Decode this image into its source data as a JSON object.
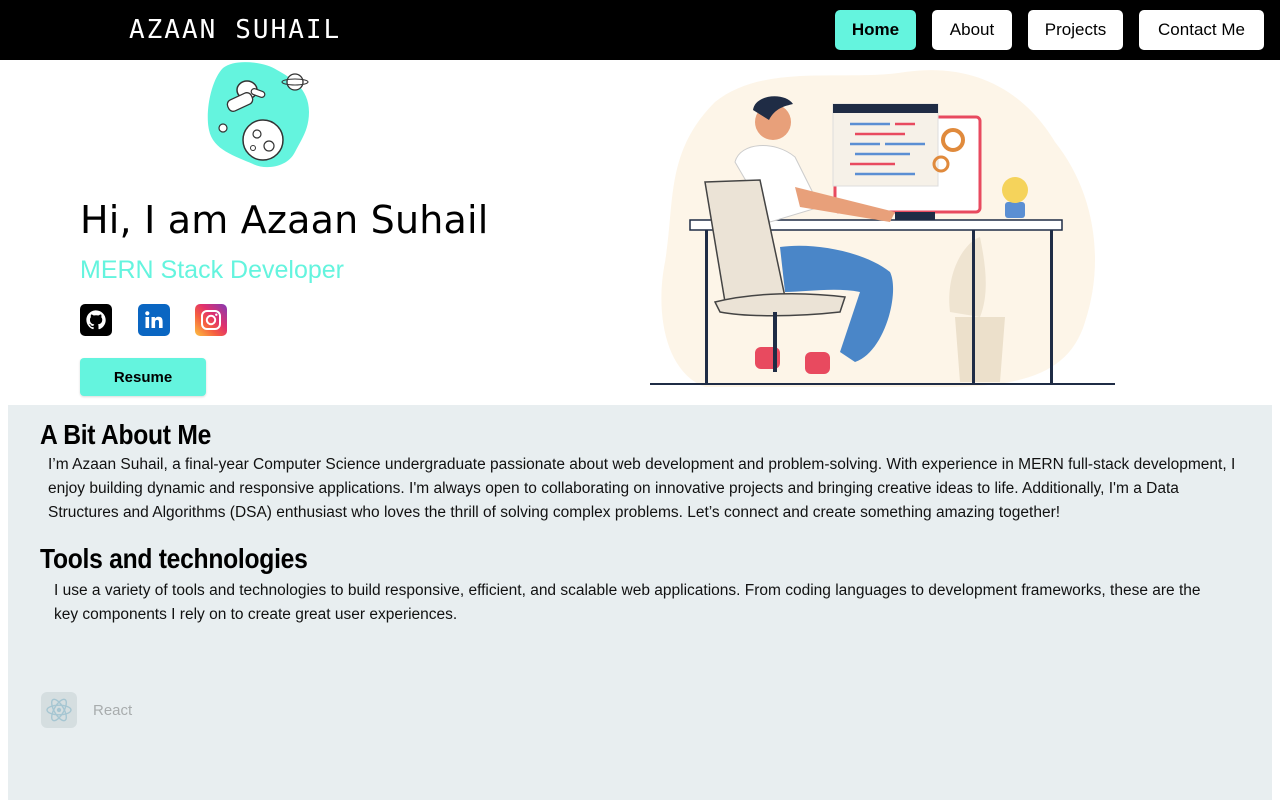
{
  "nav": {
    "brand_first": "AZAAN",
    "brand_second": "SUHAIL",
    "items": [
      {
        "label": "Home",
        "active": true
      },
      {
        "label": "About",
        "active": false
      },
      {
        "label": "Projects",
        "active": false
      },
      {
        "label": "Contact Me",
        "active": false
      }
    ]
  },
  "hero": {
    "title": "Hi, I am Azaan Suhail",
    "subtitle": "MERN Stack Developer",
    "socials": [
      {
        "icon": "github-icon",
        "color": "#000000"
      },
      {
        "icon": "linkedin-icon",
        "color": "#0a66c2"
      },
      {
        "icon": "instagram-icon",
        "color": "#e1306c"
      }
    ],
    "resume_label": "Resume"
  },
  "about": {
    "heading": "A Bit About Me",
    "text": "I’m Azaan Suhail, a final-year Computer Science undergraduate passionate about web development and problem-solving. With experience in MERN full-stack development, I enjoy building dynamic and responsive applications. I'm always open to collaborating on innovative projects and bringing creative ideas to life. Additionally, I'm a Data Structures and Algorithms (DSA) enthusiast who loves the thrill of solving complex problems. Let’s connect and create something amazing together!"
  },
  "tools": {
    "heading": "Tools and technologies",
    "text": "I use a variety of tools and technologies to build responsive, efficient, and scalable web applications. From coding languages to development frameworks, these are the key components I rely on to create great user experiences.",
    "items": [
      {
        "label": "React",
        "icon": "react-icon"
      }
    ]
  },
  "colors": {
    "accent": "#64f4de",
    "nav_bg": "#000000",
    "section_bg": "#e8eef0"
  }
}
